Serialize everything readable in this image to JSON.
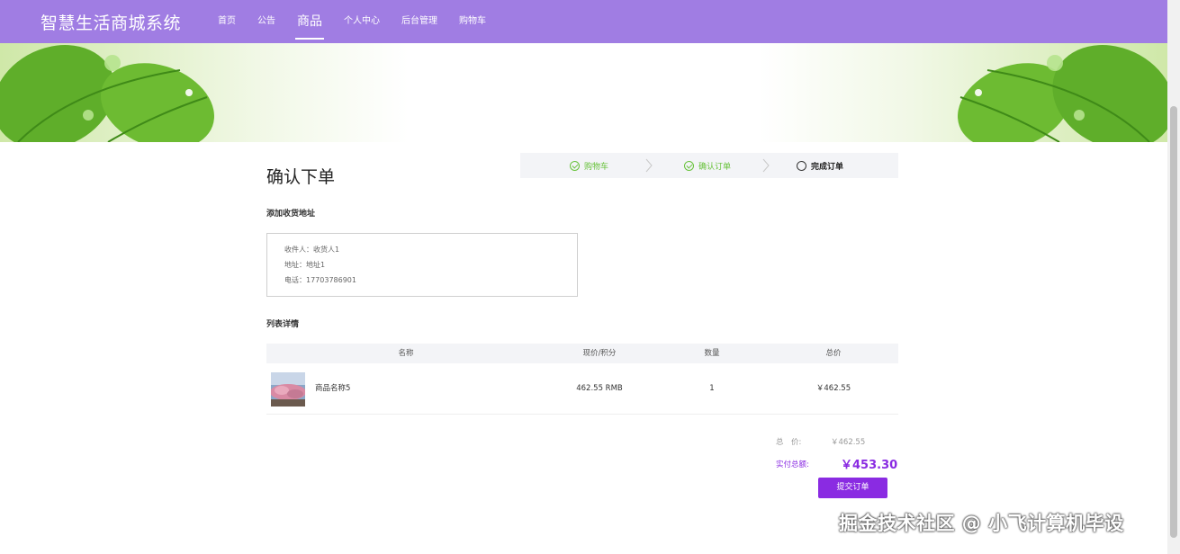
{
  "header": {
    "brand": "智慧生活商城系统",
    "nav": [
      "首页",
      "公告",
      "商品",
      "个人中心",
      "后台管理",
      "购物车"
    ],
    "active_index": 2,
    "bg_color": "#a07de3"
  },
  "page": {
    "title": "确认下单",
    "steps": [
      "购物车",
      "确认订单",
      "完成订单"
    ],
    "address_section_label": "添加收货地址",
    "address": {
      "recipient": "收件人：收货人1",
      "address": "地址：地址1",
      "phone": "电话：17703786901"
    },
    "list_section_label": "列表详情"
  },
  "table": {
    "headers": [
      "名称",
      "现价/积分",
      "数量",
      "总价"
    ],
    "rows": [
      {
        "name": "商品名称5",
        "price": "462.55 RMB",
        "qty": "1",
        "total": "￥462.55"
      }
    ]
  },
  "summary": {
    "total_label": "总　价:",
    "total_value": "￥462.55",
    "pay_label": "实付总额:",
    "pay_value": "￥453.30",
    "submit_label": "提交订单",
    "accent_color": "#8a2be2"
  },
  "watermark": "掘金技术社区 @ 小飞计算机毕设"
}
